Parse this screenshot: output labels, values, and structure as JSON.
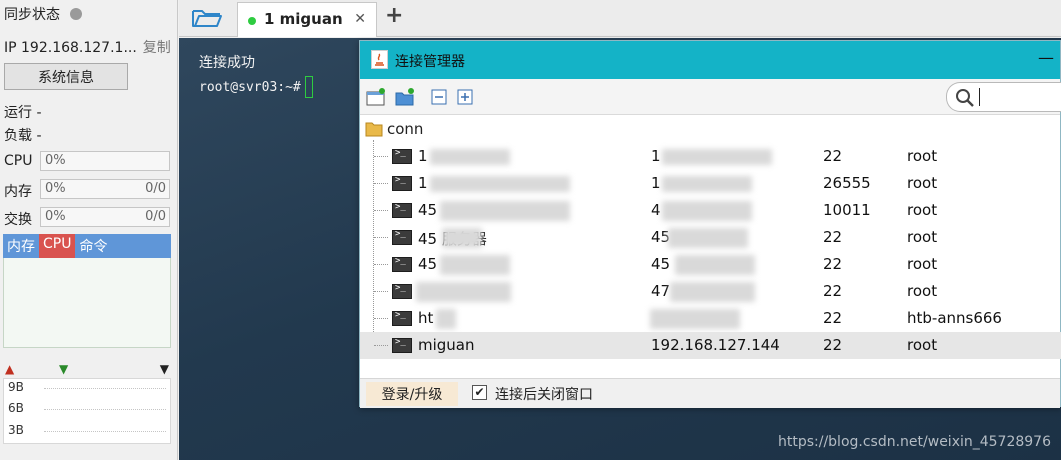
{
  "sidebar": {
    "sync_label": "同步状态",
    "ip_label": "IP 192.168.127.1...",
    "copy_label": "复制",
    "sysinfo_button": "系统信息",
    "run_label": "运行 -",
    "load_label": "负载 -",
    "meters": [
      {
        "label": "CPU",
        "percent": "0%",
        "ratio": ""
      },
      {
        "label": "内存",
        "percent": "0%",
        "ratio": "0/0"
      },
      {
        "label": "交换",
        "percent": "0%",
        "ratio": "0/0"
      }
    ],
    "proc_tabs": [
      "内存",
      "CPU",
      "命令"
    ],
    "net_scale": [
      "9B",
      "6B",
      "3B"
    ]
  },
  "tabs": {
    "items": [
      {
        "label": "1 miguan",
        "status_color": "#2ecc40"
      }
    ],
    "add_label": "+"
  },
  "terminal": {
    "line1": "连接成功",
    "prompt": "root@svr03:~#"
  },
  "dialog": {
    "title": "连接管理器",
    "minimize_glyph": "—",
    "search_placeholder": "",
    "root_folder": "conn",
    "rows": [
      {
        "name": "1",
        "host": "1",
        "port": "22",
        "user": "root"
      },
      {
        "name": "1",
        "host": "1",
        "port": "26555",
        "user": "root"
      },
      {
        "name": "45",
        "host": "4",
        "port": "10011",
        "user": "root"
      },
      {
        "name": "45 服务器",
        "host": "45",
        "port": "22",
        "user": "root"
      },
      {
        "name": "45",
        "host": "45",
        "port": "22",
        "user": "root"
      },
      {
        "name": "",
        "host": "47",
        "port": "22",
        "user": "root"
      },
      {
        "name": "ht",
        "host": "",
        "port": "22",
        "user": "htb-anns666"
      },
      {
        "name": "miguan",
        "host": "192.168.127.144",
        "port": "22",
        "user": "root"
      }
    ],
    "login_button": "登录/升级",
    "close_after_connect": "连接后关闭窗口",
    "close_after_connect_checked": true
  },
  "watermark": "https://blog.csdn.net/weixin_45728976"
}
